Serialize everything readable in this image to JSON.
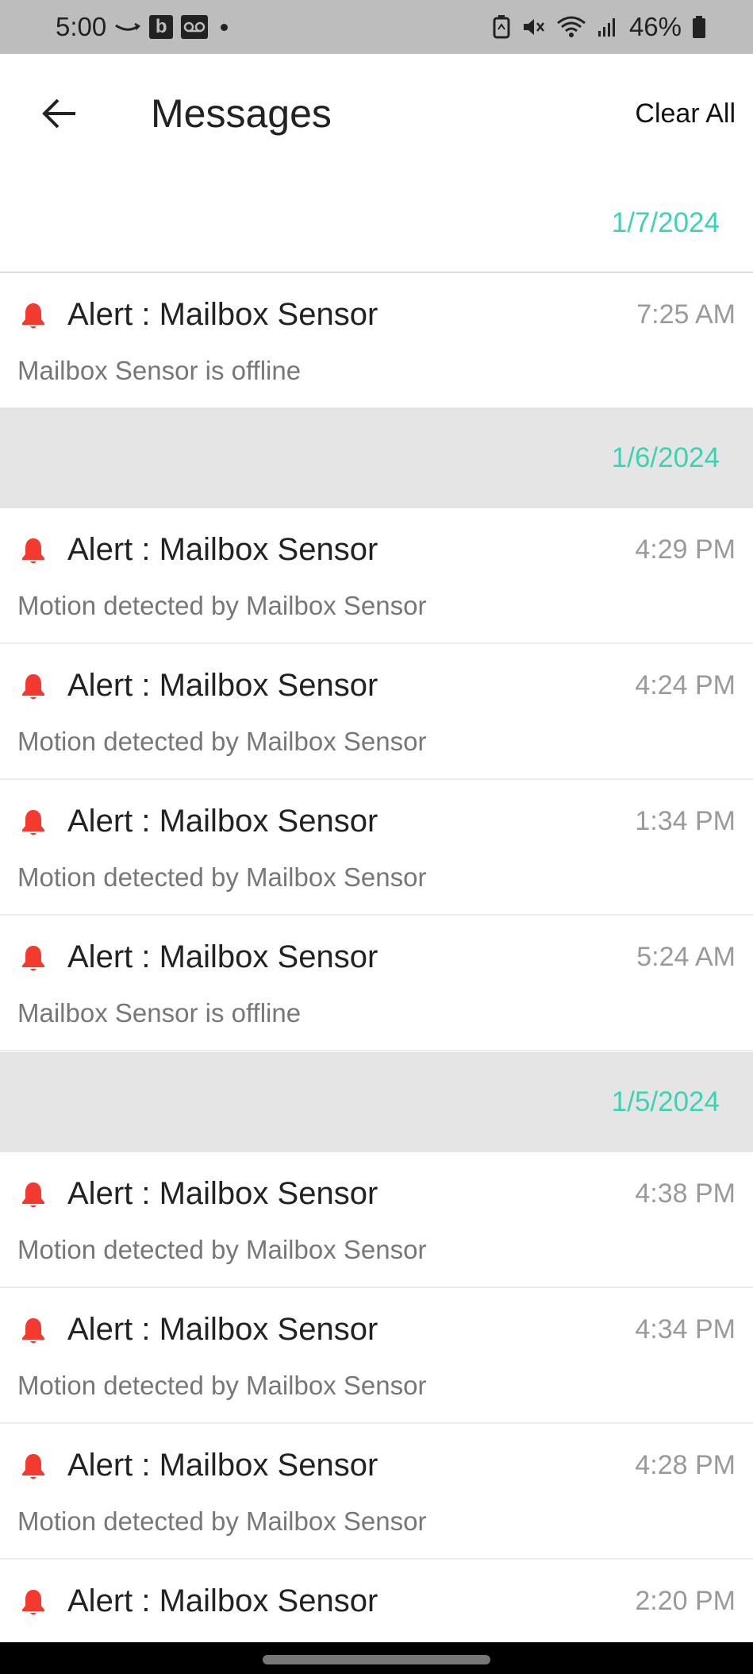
{
  "status_bar": {
    "time": "5:00",
    "left_badge": "b",
    "battery": "46%",
    "icons": [
      "amazon-smile-icon",
      "voicemail-icon",
      "dot-icon",
      "battery-saver-icon",
      "mute-icon",
      "wifi-icon",
      "signal-icon",
      "battery-icon"
    ]
  },
  "header": {
    "title": "Messages",
    "clear_label": "Clear All"
  },
  "colors": {
    "date": "#3ed2b4",
    "bell": "#f4392e",
    "group_bg": "#e5e5e5"
  },
  "groups": [
    {
      "date": "1/7/2024",
      "items": [
        {
          "title": "Alert : Mailbox Sensor",
          "time": "7:25 AM",
          "message": "Mailbox Sensor  is offline"
        }
      ]
    },
    {
      "date": "1/6/2024",
      "items": [
        {
          "title": "Alert : Mailbox Sensor",
          "time": "4:29 PM",
          "message": "Motion detected by Mailbox Sensor"
        },
        {
          "title": "Alert : Mailbox Sensor",
          "time": "4:24 PM",
          "message": "Motion detected by Mailbox Sensor"
        },
        {
          "title": "Alert : Mailbox Sensor",
          "time": "1:34 PM",
          "message": "Motion detected by Mailbox Sensor"
        },
        {
          "title": "Alert : Mailbox Sensor",
          "time": "5:24 AM",
          "message": "Mailbox Sensor  is offline"
        }
      ]
    },
    {
      "date": "1/5/2024",
      "items": [
        {
          "title": "Alert : Mailbox Sensor",
          "time": "4:38 PM",
          "message": "Motion detected by Mailbox Sensor"
        },
        {
          "title": "Alert : Mailbox Sensor",
          "time": "4:34 PM",
          "message": "Motion detected by Mailbox Sensor"
        },
        {
          "title": "Alert : Mailbox Sensor",
          "time": "4:28 PM",
          "message": "Motion detected by Mailbox Sensor"
        },
        {
          "title": "Alert : Mailbox Sensor",
          "time": "2:20 PM",
          "message": ""
        }
      ]
    }
  ]
}
